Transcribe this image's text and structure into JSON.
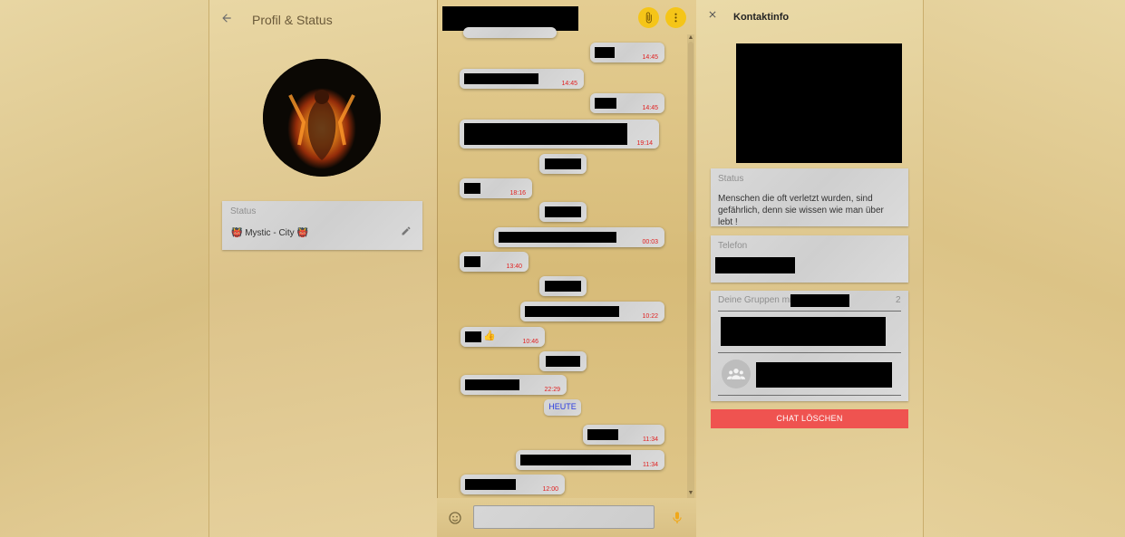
{
  "profile_panel": {
    "title": "Profil & Status",
    "back_icon": "arrow-left-icon",
    "avatar": "fire-figure-avatar",
    "status_label": "Status",
    "status_text": "👹 Mystic - City 👹",
    "edit_icon": "pencil-icon"
  },
  "chat": {
    "header_icons": [
      "paperclip-icon",
      "more-vertical-icon"
    ],
    "accent_color": "#f5c518",
    "messages": [
      {
        "time": "14:45"
      },
      {
        "time": "14:45"
      },
      {
        "time": "14:45"
      },
      {
        "time": "19:14"
      },
      {
        "time": ""
      },
      {
        "time": "18:16"
      },
      {
        "time": ""
      },
      {
        "time": "00:03"
      },
      {
        "time": "13:40"
      },
      {
        "time": ""
      },
      {
        "time": "10:22"
      },
      {
        "time": "10:46",
        "emoji": "👍"
      },
      {
        "time": ""
      },
      {
        "time": "22:29"
      },
      {
        "time": "11:34"
      },
      {
        "time": "11:34"
      },
      {
        "time": "12:00"
      }
    ],
    "date_separator": "HEUTE",
    "input_placeholder": "",
    "emoji_icon": "smiley-icon",
    "mic_icon": "microphone-icon"
  },
  "contact_panel": {
    "title": "Kontaktinfo",
    "close_icon": "close-icon",
    "status_label": "Status",
    "status_text": "Menschen die oft verletzt wurden, sind gefährlich, denn sie wissen wie man über lebt !",
    "phone_label": "Telefon",
    "groups_label": "Deine Gruppen mit",
    "groups_count": "2",
    "group_icon": "group-people-icon",
    "delete_button": "CHAT LÖSCHEN",
    "delete_color": "#ef5350"
  }
}
